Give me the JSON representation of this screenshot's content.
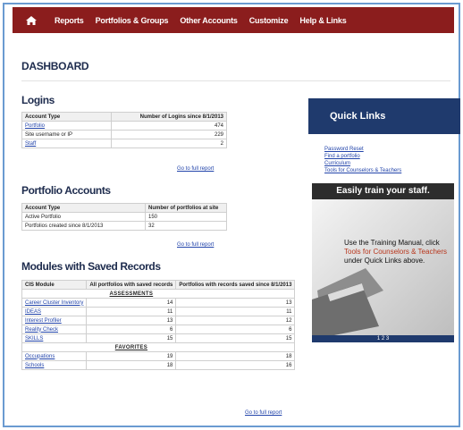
{
  "nav": {
    "items": [
      "Reports",
      "Portfolios & Groups",
      "Other Accounts",
      "Customize",
      "Help & Links"
    ]
  },
  "page": {
    "title": "DASHBOARD"
  },
  "logins": {
    "title": "Logins",
    "columns": [
      "Account Type",
      "Number of Logins since 8/1/2013"
    ],
    "rows": [
      {
        "label": "Portfolio",
        "value": "474"
      },
      {
        "label": "Site username or IP",
        "value": "229"
      },
      {
        "label": "Staff",
        "value": "2"
      }
    ],
    "full_report": "Go to full report"
  },
  "portfolio_accounts": {
    "title": "Portfolio Accounts",
    "columns": [
      "Account Type",
      "Number of portfolios at site"
    ],
    "rows": [
      {
        "label": "Active Portfolio",
        "value": "150"
      },
      {
        "label": "Portfolios created since 8/1/2013",
        "value": "32"
      }
    ],
    "full_report": "Go to full report"
  },
  "modules": {
    "title": "Modules with Saved Records",
    "columns": [
      "CIS Module",
      "All portfolios with saved records",
      "Portfolios with records saved since 8/1/2013"
    ],
    "assessments_label": "ASSESSMENTS",
    "assessments": [
      {
        "label": "Career Cluster Inventory",
        "all": "14",
        "since": "13"
      },
      {
        "label": "IDEAS",
        "all": "11",
        "since": "11"
      },
      {
        "label": "Interest Profiler",
        "all": "13",
        "since": "12"
      },
      {
        "label": "Reality Check",
        "all": "6",
        "since": "6"
      },
      {
        "label": "SKILLS",
        "all": "15",
        "since": "15"
      }
    ],
    "favorites_label": "FAVORITES",
    "favorites": [
      {
        "label": "Occupations",
        "all": "19",
        "since": "18"
      },
      {
        "label": "Schools",
        "all": "18",
        "since": "16"
      }
    ],
    "full_report": "Go to full report"
  },
  "quick_links": {
    "title": "Quick Links",
    "links": [
      "Password Reset",
      "Find a portfolio",
      "Curriculum",
      "Tools for Counselors & Teachers"
    ]
  },
  "promo": {
    "headline": "Easily train your staff.",
    "text_1": "Use the Training Manual, click ",
    "highlight": "Tools for Counselors & Teachers",
    "text_2": " under Quick Links above.",
    "pager": "1 2 3"
  },
  "colors": {
    "nav_bg": "#8b1d1d",
    "quick_links_bg": "#1f3a6d",
    "link": "#2244aa"
  }
}
